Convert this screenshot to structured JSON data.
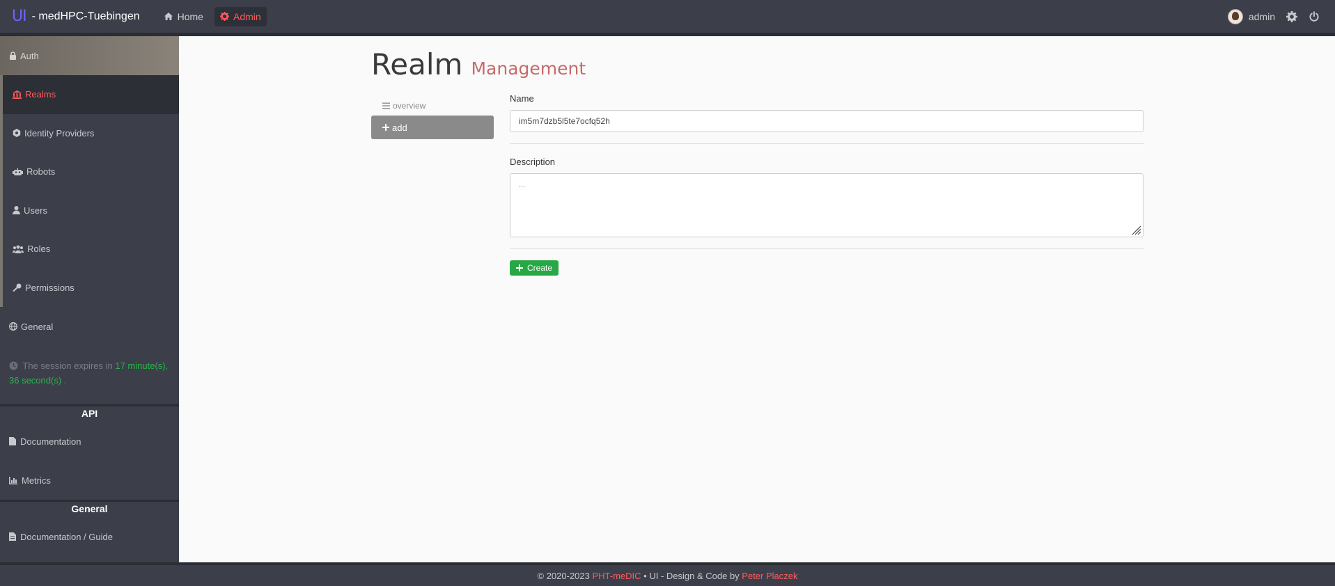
{
  "header": {
    "brand": {
      "logo": "UI",
      "name": "- medHPC-Tuebingen"
    },
    "nav": [
      {
        "label": "Home",
        "icon": "home-icon"
      },
      {
        "label": "Admin",
        "icon": "gear-icon",
        "active": true
      }
    ],
    "user": {
      "name": "admin"
    },
    "icons": [
      "settings-icon",
      "power-icon"
    ]
  },
  "sidebar": {
    "auth_label": "Auth",
    "items": [
      {
        "label": "Realms",
        "icon": "institution-icon",
        "active": true
      },
      {
        "label": "Identity Providers",
        "icon": "id-icon"
      },
      {
        "label": "Robots",
        "icon": "robot-icon"
      },
      {
        "label": "Users",
        "icon": "user-icon"
      },
      {
        "label": "Roles",
        "icon": "users-icon"
      },
      {
        "label": "Permissions",
        "icon": "key-icon"
      }
    ],
    "general_label": "General",
    "session": {
      "prefix": "The session expires in",
      "time": "17 minute(s), 36 second(s)",
      "suffix": "."
    },
    "api_heading": "API",
    "api_items": [
      {
        "label": "Documentation",
        "icon": "file-icon"
      },
      {
        "label": "Metrics",
        "icon": "chart-icon"
      }
    ],
    "general_heading": "General",
    "general_items": [
      {
        "label": "Documentation / Guide",
        "icon": "file-text-icon"
      }
    ]
  },
  "main": {
    "title": "Realm",
    "subtitle": "Management",
    "tabs": {
      "overview": "overview",
      "add": "add"
    },
    "form": {
      "name_label": "Name",
      "name_value": "im5m7dzb5l5te7ocfq52h",
      "description_label": "Description",
      "description_placeholder": "...",
      "create_label": "Create"
    }
  },
  "footer": {
    "copyright": "© 2020-2023",
    "project": "PHT-meDIC",
    "mid": "• UI - Design & Code by",
    "author": "Peter Placzek"
  },
  "colors": {
    "accent": "#ff5a5a",
    "success": "#28a745",
    "sidebar": "#3c3f4a",
    "session_time": "#29b449"
  }
}
